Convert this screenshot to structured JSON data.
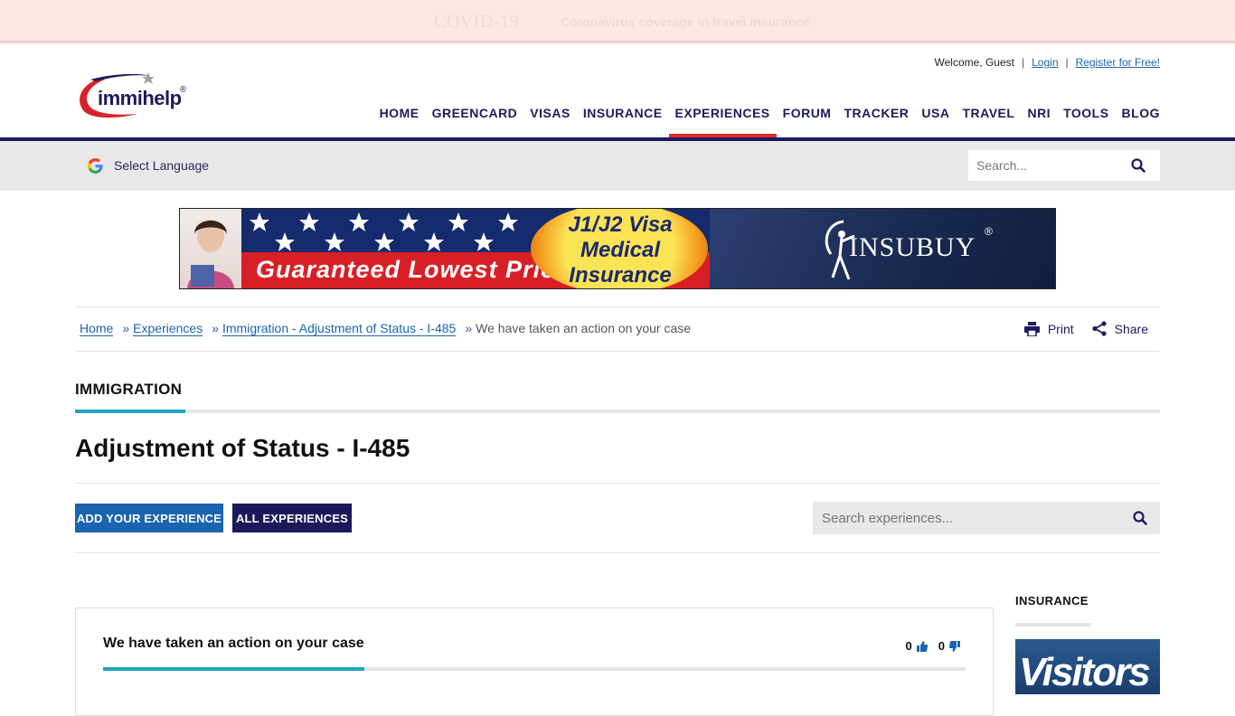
{
  "covid_banner": {
    "badge": "COVID-19",
    "text": "Coronavirus coverage in travel insurance"
  },
  "header": {
    "logo_text": "immihelp",
    "logo_reg": "®",
    "welcome": "Welcome, Guest",
    "login": "Login",
    "register": "Register for Free!",
    "nav": [
      "HOME",
      "GREENCARD",
      "VISAS",
      "INSURANCE",
      "EXPERIENCES",
      "FORUM",
      "TRACKER",
      "USA",
      "TRAVEL",
      "NRI",
      "TOOLS",
      "BLOG"
    ],
    "active_nav": "EXPERIENCES",
    "active_color": "#e02a2a",
    "brand_color": "#1d1a5c"
  },
  "strip": {
    "language_label": "Select Language",
    "search_placeholder": "Search..."
  },
  "ad_banner": {
    "slogan": "Guaranteed Lowest Price",
    "visa_line1": "J1/J2 Visa",
    "visa_line2": "Medical",
    "visa_line3": "Insurance",
    "brand": "INSUBUY",
    "brand_reg": "®"
  },
  "breadcrumb": {
    "items": [
      "Home",
      "Experiences",
      "Immigration - Adjustment of Status - I-485"
    ],
    "separator": "»",
    "current": "We have taken an action on your case"
  },
  "tools": {
    "print": "Print",
    "share": "Share"
  },
  "section": {
    "label": "IMMIGRATION",
    "title": "Adjustment of Status - I-485",
    "add_button": "ADD YOUR EXPERIENCE",
    "all_button": "ALL EXPERIENCES",
    "search_placeholder": "Search experiences...",
    "accent_color": "#1fa5c1"
  },
  "card": {
    "title": "We have taken an action on your case",
    "upvotes": "0",
    "downvotes": "0"
  },
  "sidebar": {
    "label": "INSURANCE",
    "ad_text": "Visitors"
  }
}
